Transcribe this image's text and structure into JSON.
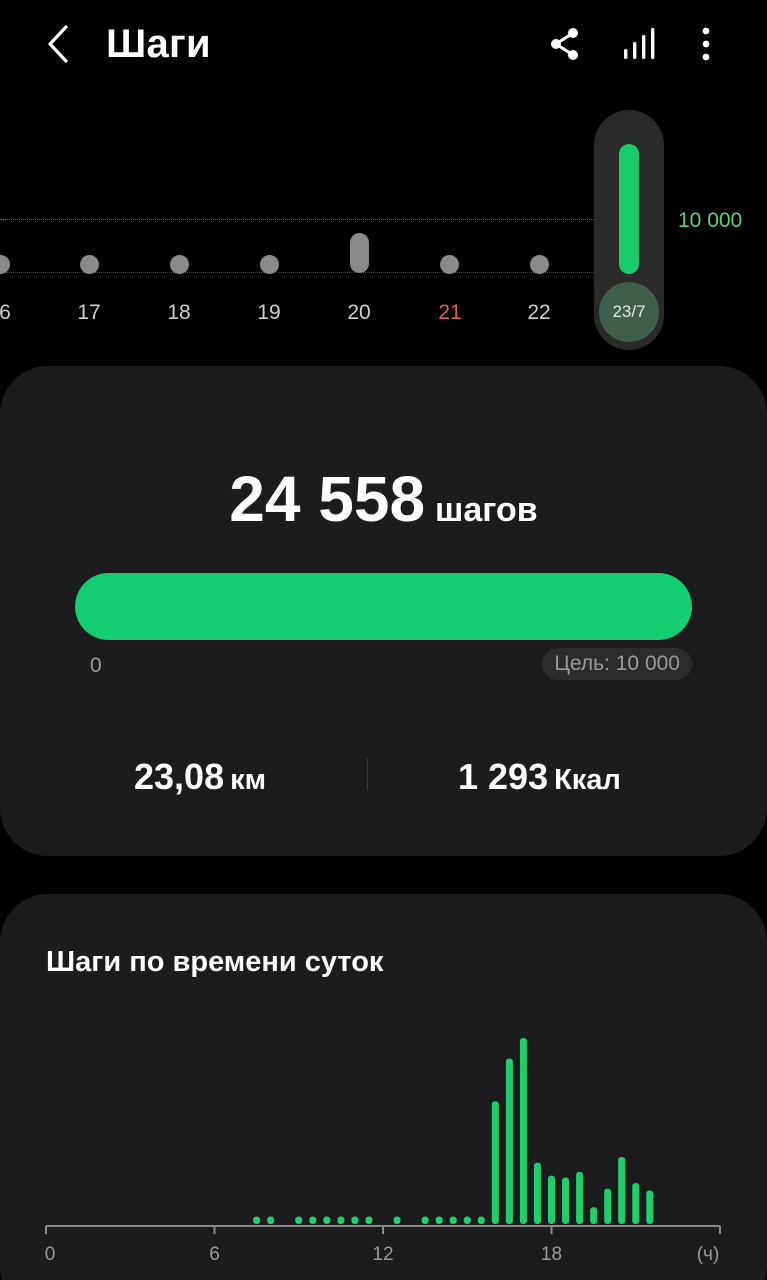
{
  "header": {
    "title": "Шаги",
    "icons": [
      "back-arrow-icon",
      "share-icon",
      "bar-chart-icon",
      "more-vert-icon"
    ]
  },
  "day_strip": {
    "goal_label": "10 000",
    "days": [
      {
        "label": "6",
        "weekend": false
      },
      {
        "label": "17",
        "weekend": false
      },
      {
        "label": "18",
        "weekend": false
      },
      {
        "label": "19",
        "weekend": false
      },
      {
        "label": "20",
        "weekend": false
      },
      {
        "label": "21",
        "weekend": true
      },
      {
        "label": "22",
        "weekend": false
      }
    ],
    "selected_day": "23/7"
  },
  "summary": {
    "steps": "24 558",
    "steps_unit": "шагов",
    "progress_fraction": 1.0,
    "progress_start": "0",
    "goal_text": "Цель: 10 000",
    "distance_value": "23,08",
    "distance_unit": "км",
    "calories_value": "1 293",
    "calories_unit": "Ккал"
  },
  "hourly": {
    "title": "Шаги по времени суток",
    "x_tick_labels": [
      "0",
      "6",
      "12",
      "18"
    ],
    "x_unit_label": "(ч)"
  },
  "chart_data": {
    "type": "bar",
    "title": "Шаги по времени суток",
    "xlabel": "(ч)",
    "xlim": [
      0,
      24
    ],
    "x_ticks": [
      0,
      6,
      12,
      18
    ],
    "x": [
      7.5,
      8.0,
      9.0,
      9.5,
      10.0,
      10.5,
      11.0,
      11.5,
      12.5,
      13.5,
      14.0,
      14.5,
      15.0,
      15.5,
      16.0,
      16.5,
      17.0,
      17.5,
      18.0,
      18.5,
      19.0,
      19.5,
      20.0,
      20.5,
      21.0,
      21.5
    ],
    "values": [
      0.04,
      0.04,
      0.04,
      0.04,
      0.04,
      0.04,
      0.04,
      0.04,
      0.04,
      0.04,
      0.04,
      0.04,
      0.04,
      0.04,
      0.66,
      0.89,
      1.0,
      0.33,
      0.26,
      0.25,
      0.28,
      0.09,
      0.19,
      0.36,
      0.22,
      0.18
    ],
    "grid": false,
    "colors": {
      "bar": "#1fcf6c",
      "axis": "#8a8a8a"
    }
  },
  "colors": {
    "accent": "#14cf72",
    "card": "#1c1c1e",
    "weekend": "#e0605e",
    "goal_line": "#5fcf80"
  }
}
